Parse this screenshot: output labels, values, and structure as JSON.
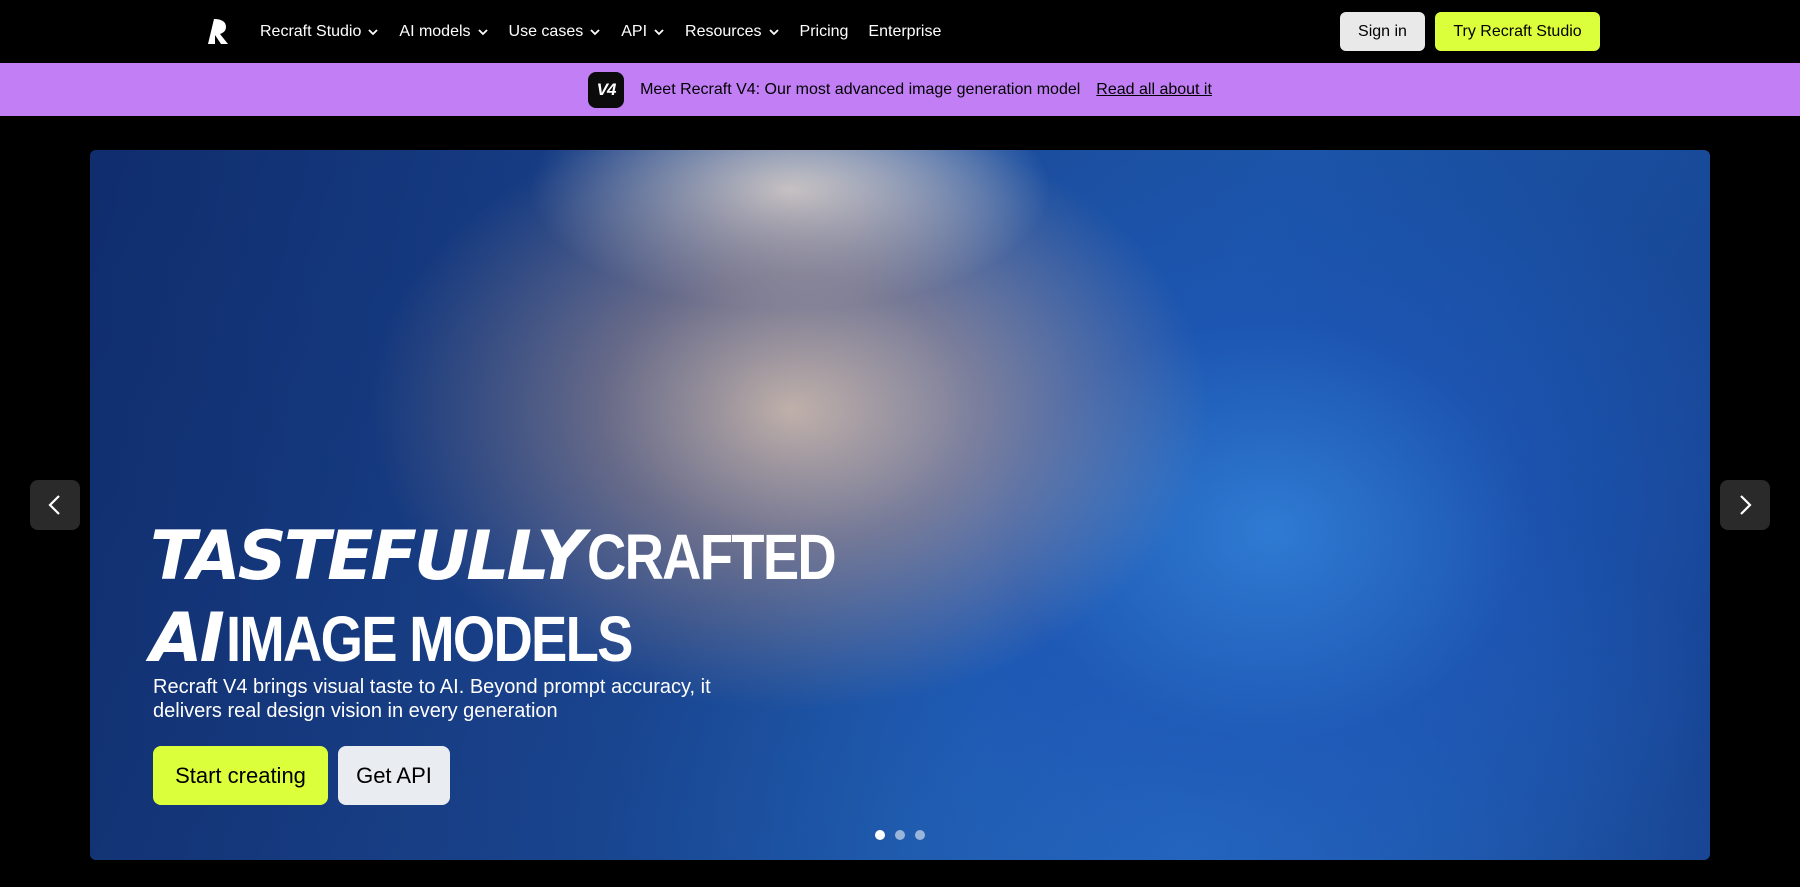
{
  "nav": {
    "logo": "recraft-logo",
    "items": [
      {
        "label": "Recraft Studio",
        "dropdown": true
      },
      {
        "label": "AI models",
        "dropdown": true
      },
      {
        "label": "Use cases",
        "dropdown": true
      },
      {
        "label": "API",
        "dropdown": true
      },
      {
        "label": "Resources",
        "dropdown": true
      },
      {
        "label": "Pricing",
        "dropdown": false
      },
      {
        "label": "Enterprise",
        "dropdown": false
      }
    ],
    "signin_label": "Sign in",
    "try_label": "Try Recraft Studio"
  },
  "announcement": {
    "badge": "V4",
    "text": "Meet Recraft V4: Our most advanced image generation model",
    "link": "Read all about it"
  },
  "hero": {
    "title_line1_italic": "TASTEFULLY",
    "title_line1_plain": "CRAFTED",
    "title_line2_italic": "AI",
    "title_line2_plain": "IMAGE MODELS",
    "description": "Recraft V4 brings visual taste to AI. Beyond prompt accuracy, it delivers real design vision in every generation",
    "primary_cta": "Start creating",
    "secondary_cta": "Get API",
    "slides_total": 3,
    "active_slide": 1
  },
  "colors": {
    "accent": "#dbff3b",
    "announcement_bg": "#c17ef5",
    "page_bg": "#000000"
  }
}
